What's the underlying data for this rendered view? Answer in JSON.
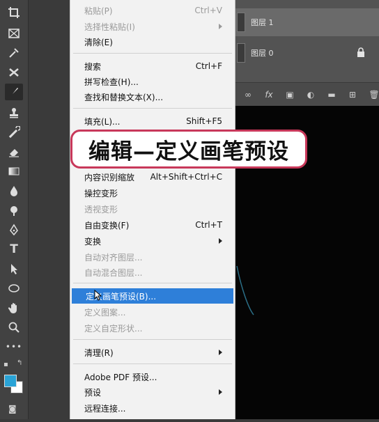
{
  "layers": {
    "items": [
      {
        "label": "图层 1",
        "selected": true
      },
      {
        "label": "图层 0",
        "selected": false,
        "locked": true
      }
    ]
  },
  "menu": {
    "items": [
      {
        "label": "粘贴(P)",
        "shortcut": "Ctrl+V",
        "disabled": true
      },
      {
        "label": "选择性粘贴(I)",
        "submenu": true,
        "disabled": true
      },
      {
        "label": "清除(E)"
      },
      {
        "label": "搜索",
        "shortcut": "Ctrl+F"
      },
      {
        "label": "拼写检查(H)..."
      },
      {
        "label": "查找和替换文本(X)..."
      },
      {
        "label": "填充(L)...",
        "shortcut": "Shift+F5"
      },
      {
        "label": "内容识别缩放",
        "shortcut": "Alt+Shift+Ctrl+C"
      },
      {
        "label": "操控变形"
      },
      {
        "label": "透视变形",
        "disabled": true
      },
      {
        "label": "自由变换(F)",
        "shortcut": "Ctrl+T"
      },
      {
        "label": "变换",
        "submenu": true
      },
      {
        "label": "自动对齐图层...",
        "disabled": true
      },
      {
        "label": "自动混合图层...",
        "disabled": true
      },
      {
        "label": "定义画笔预设(B)...",
        "highlighted": true
      },
      {
        "label": "定义图案...",
        "disabled": true
      },
      {
        "label": "定义自定形状...",
        "disabled": true
      },
      {
        "label": "清理(R)",
        "submenu": true
      },
      {
        "label": "Adobe PDF 预设..."
      },
      {
        "label": "预设",
        "submenu": true
      },
      {
        "label": "远程连接..."
      }
    ]
  },
  "caption": {
    "text": "编辑—定义画笔预设"
  },
  "colors": {
    "foreground": "#29a3d6",
    "background": "#ffffff",
    "highlight": "#2e7fd9",
    "caption_border": "#c8385a"
  },
  "tools": [
    "crop-icon",
    "frame-icon",
    "eyedropper-icon",
    "healing-icon",
    "brush-icon",
    "stamp-icon",
    "history-brush-icon",
    "eraser-icon",
    "gradient-icon",
    "blur-icon",
    "dodge-icon",
    "pen-icon",
    "type-icon",
    "path-select-icon",
    "ellipse-icon",
    "hand-icon",
    "zoom-icon",
    "more-icon"
  ]
}
